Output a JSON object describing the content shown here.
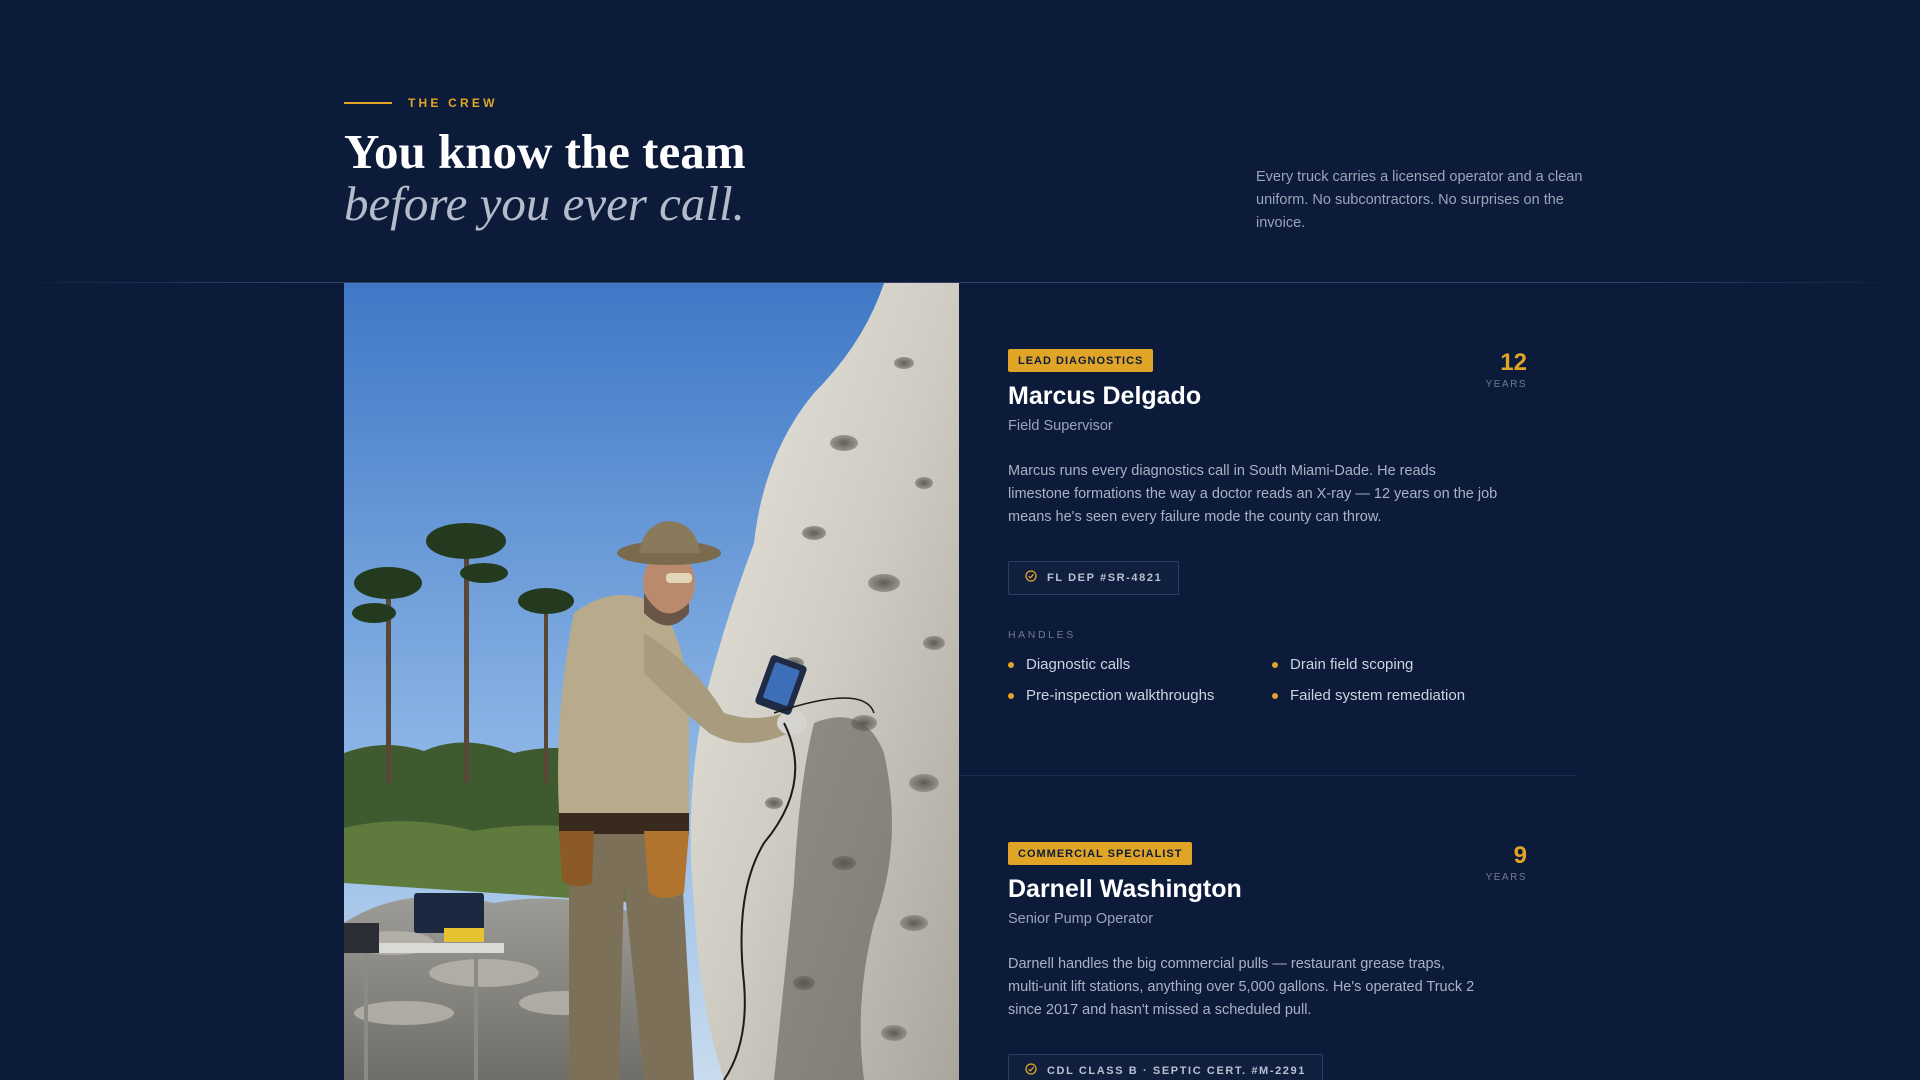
{
  "header": {
    "eyebrow": "THE CREW",
    "headline_main": "You know the team",
    "headline_sub": "before you ever call.",
    "intro": "Every truck carries a licensed operator and a clean uniform. No subcontractors. No surprises on the invoice."
  },
  "crew": [
    {
      "role": "LEAD DIAGNOSTICS",
      "name": "Marcus Delgado",
      "title": "Field Supervisor",
      "bio": "Marcus runs every diagnostics call in South Miami-Dade. He reads limestone formations the way a doctor reads an X-ray — 12 years on the job means he's seen every failure mode the county can throw.",
      "years": "12",
      "years_label": "YEARS",
      "cert": "FL DEP #SR-4821",
      "handles_label": "HANDLES",
      "handles": [
        "Diagnostic calls",
        "Drain field scoping",
        "Pre-inspection walkthroughs",
        "Failed system remediation"
      ]
    },
    {
      "role": "COMMERCIAL SPECIALIST",
      "name": "Darnell Washington",
      "title": "Senior Pump Operator",
      "bio": "Darnell handles the big commercial pulls — restaurant grease traps, multi-unit lift stations, anything over 5,000 gallons. He's operated Truck 2 since 2017 and hasn't missed a scheduled pull.",
      "years": "9",
      "years_label": "YEARS",
      "cert": "CDL CLASS B · SEPTIC CERT. #M-2291"
    }
  ],
  "colors": {
    "background": "#0d1b3a",
    "accent": "#e0a526"
  },
  "icons": {
    "cert": "check-badge-icon",
    "bullet": "dot-icon"
  }
}
